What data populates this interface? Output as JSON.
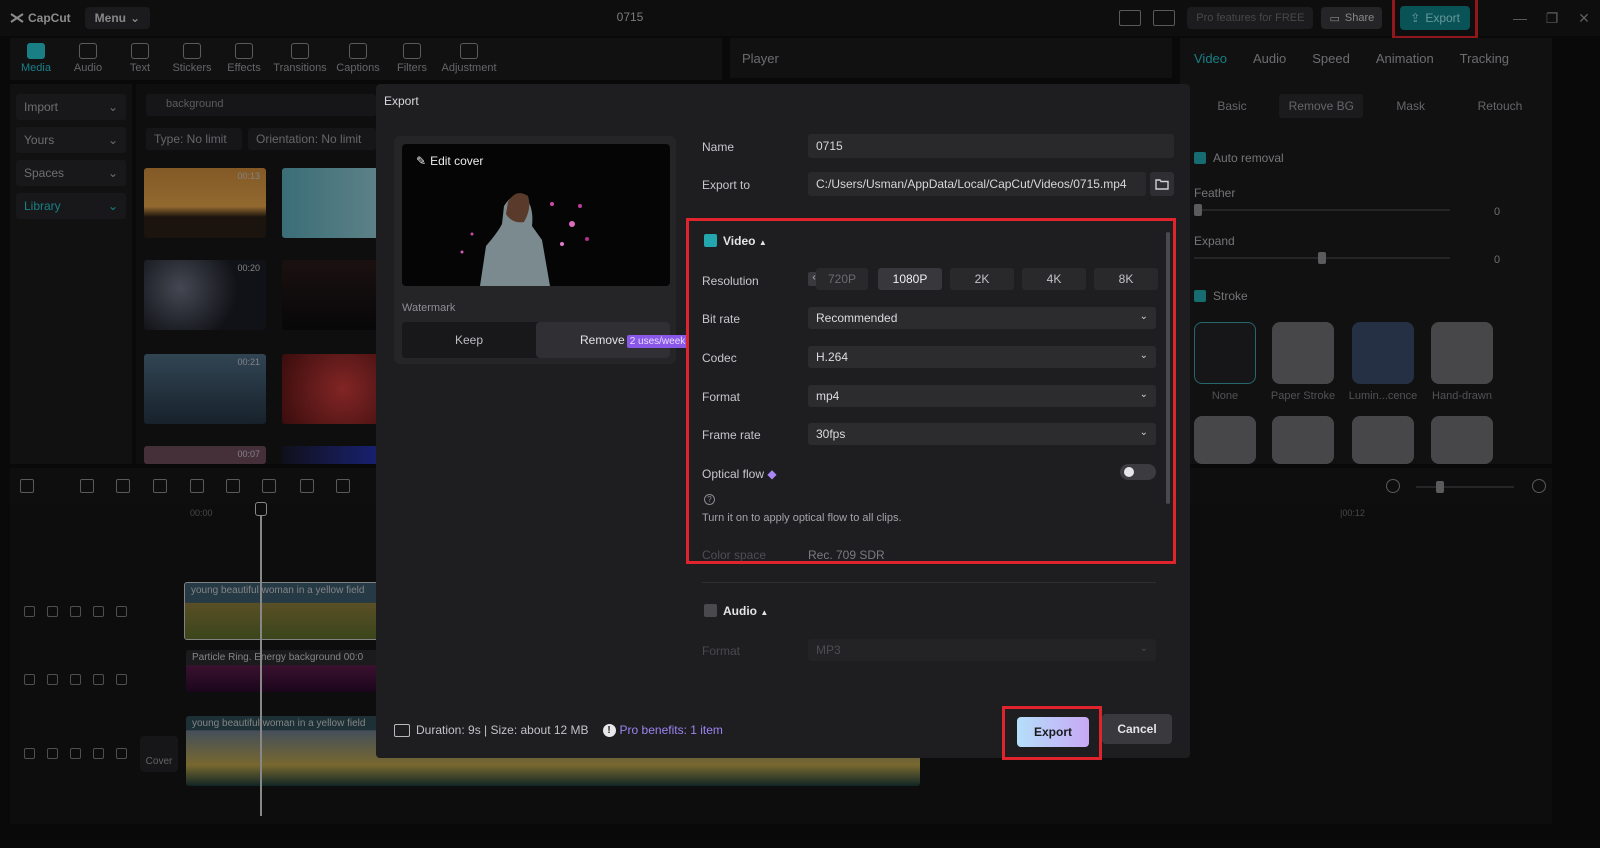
{
  "app": {
    "name": "CapCut",
    "menu_label": "Menu",
    "document_title": "0715",
    "pro_features_label": "Pro features for FREE",
    "share_label": "Share",
    "export_label": "Export"
  },
  "toolbar": {
    "tools": [
      {
        "label": "Media",
        "icon": "media-icon"
      },
      {
        "label": "Audio",
        "icon": "audio-icon"
      },
      {
        "label": "Text",
        "icon": "text-icon"
      },
      {
        "label": "Stickers",
        "icon": "stickers-icon"
      },
      {
        "label": "Effects",
        "icon": "effects-icon"
      },
      {
        "label": "Transitions",
        "icon": "transitions-icon"
      },
      {
        "label": "Captions",
        "icon": "captions-icon"
      },
      {
        "label": "Filters",
        "icon": "filters-icon"
      },
      {
        "label": "Adjustment",
        "icon": "adjustment-icon"
      }
    ]
  },
  "leftnav": {
    "items": [
      "Import",
      "Yours",
      "Spaces",
      "Library"
    ]
  },
  "media": {
    "search_placeholder": "background",
    "filter_type": "Type: No limit",
    "filter_orientation": "Orientation: No limit",
    "thumb_durations": [
      "00:13",
      "00:20",
      "00:21",
      "00:07"
    ]
  },
  "player": {
    "label": "Player"
  },
  "right_panel": {
    "tabs": [
      "Video",
      "Audio",
      "Speed",
      "Animation",
      "Tracking"
    ],
    "subtabs": [
      "Basic",
      "Remove BG",
      "Mask",
      "Retouch"
    ],
    "auto_removal_label": "Auto removal",
    "feather_label": "Feather",
    "feather_value": "0",
    "expand_label": "Expand",
    "expand_value": "0",
    "stroke_label": "Stroke",
    "stroke_options": [
      "None",
      "Paper Stroke",
      "Lumin...cence",
      "Hand-drawn"
    ]
  },
  "timeline": {
    "ruler_start": "00:00",
    "ruler_mark": "|00:12",
    "tracks": [
      {
        "label": "young beautiful woman in a yellow field"
      },
      {
        "label": "Particle Ring. Energy background",
        "time": "00:0"
      },
      {
        "label": "young beautiful woman in a yellow field"
      }
    ],
    "cover_label": "Cover"
  },
  "export_dialog": {
    "title": "Export",
    "edit_cover_label": "Edit cover",
    "watermark_label": "Watermark",
    "watermark_keep": "Keep",
    "watermark_remove": "Remove",
    "watermark_badge": "2 uses/week",
    "name_label": "Name",
    "name_value": "0715",
    "export_to_label": "Export to",
    "export_to_value": "C:/Users/Usman/AppData/Local/CapCut/Videos/0715.mp4",
    "video_section": {
      "title": "Video",
      "checked": true,
      "resolution_label": "Resolution",
      "resolutions": [
        "720P",
        "1080P",
        "2K",
        "4K",
        "8K"
      ],
      "resolution_selected": "1080P",
      "bitrate_label": "Bit rate",
      "bitrate_value": "Recommended",
      "codec_label": "Codec",
      "codec_value": "H.264",
      "format_label": "Format",
      "format_value": "mp4",
      "framerate_label": "Frame rate",
      "framerate_value": "30fps",
      "optical_flow_label": "Optical flow",
      "optical_flow_enabled": false,
      "optical_flow_hint": "Turn it on to apply optical flow to all clips.",
      "color_space_label": "Color space",
      "color_space_value": "Rec. 709 SDR"
    },
    "audio_section": {
      "title": "Audio",
      "checked": false,
      "format_label": "Format",
      "format_value": "MP3"
    },
    "footer": {
      "duration_size": "Duration: 9s | Size: about 12 MB",
      "pro_benefits": "Pro benefits: 1 item"
    },
    "export_button": "Export",
    "cancel_button": "Cancel"
  },
  "colors": {
    "accent": "#27c3cc",
    "highlight_box": "#e0242d",
    "pro_purple": "#9d84f3"
  }
}
